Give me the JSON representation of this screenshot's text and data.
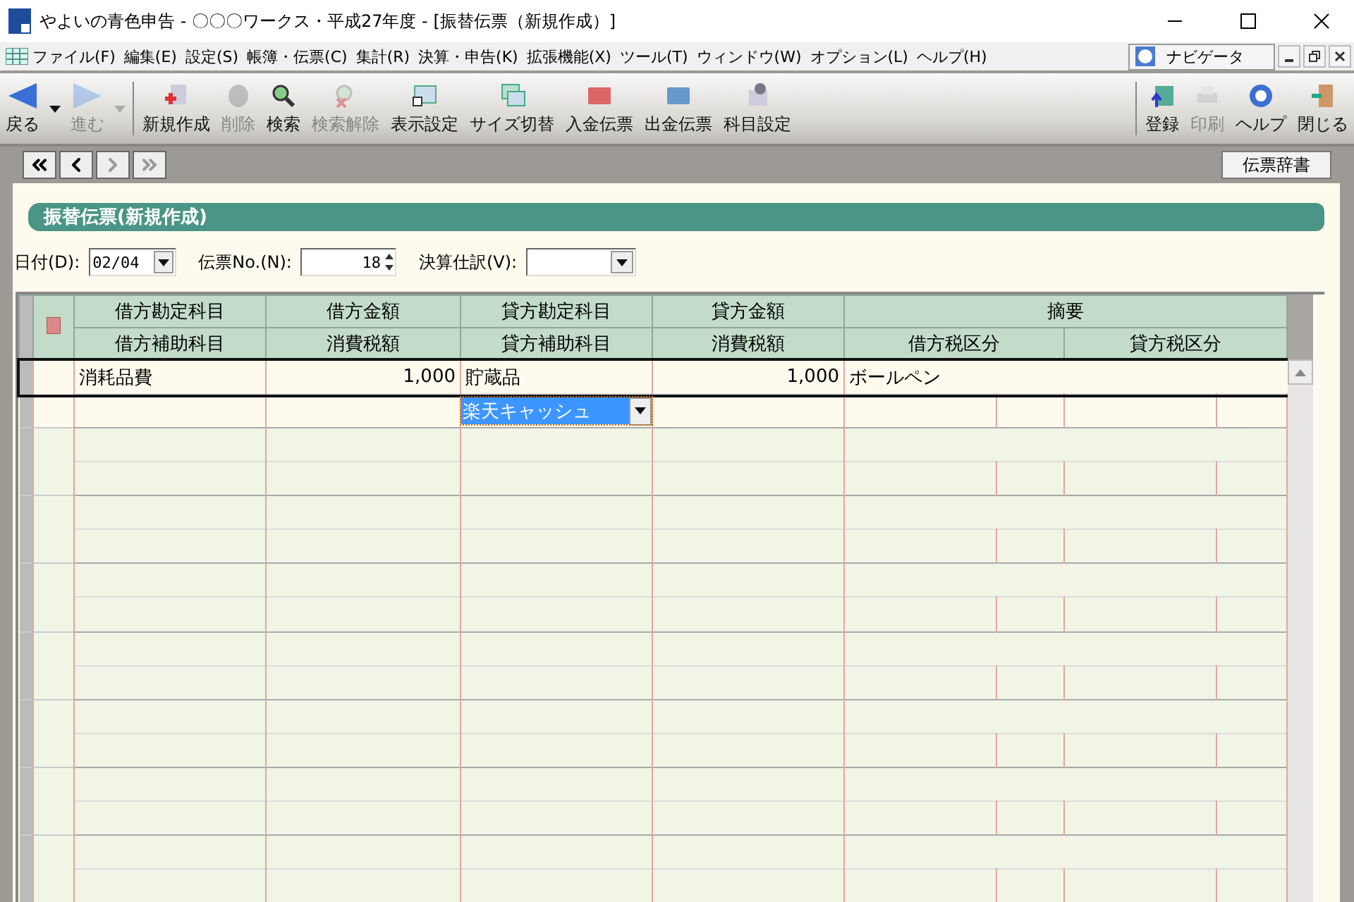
{
  "window": {
    "title": "やよいの青色申告 - 〇〇〇ワークス・平成27年度 - [振替伝票（新規作成）]"
  },
  "menu_bar": {
    "items": [
      "ファイル(F)",
      "編集(E)",
      "設定(S)",
      "帳簿・伝票(C)",
      "集計(R)",
      "決算・申告(K)",
      "拡張機能(X)",
      "ツール(T)",
      "ウィンドウ(W)",
      "オプション(L)",
      "ヘルプ(H)"
    ],
    "navigator": "ナビゲータ"
  },
  "toolbar": {
    "items": [
      {
        "label": "戻る",
        "disabled": false,
        "dropdown": true
      },
      {
        "label": "進む",
        "disabled": true,
        "dropdown": true
      },
      {
        "label": "新規作成",
        "disabled": false,
        "dropdown": false
      },
      {
        "label": "削除",
        "disabled": true,
        "dropdown": false
      },
      {
        "label": "検索",
        "disabled": false,
        "dropdown": false
      },
      {
        "label": "検索解除",
        "disabled": true,
        "dropdown": false
      },
      {
        "label": "表示設定",
        "disabled": false,
        "dropdown": false
      },
      {
        "label": "サイズ切替",
        "disabled": false,
        "dropdown": false
      },
      {
        "label": "入金伝票",
        "disabled": false,
        "dropdown": false
      },
      {
        "label": "出金伝票",
        "disabled": false,
        "dropdown": false
      },
      {
        "label": "科目設定",
        "disabled": false,
        "dropdown": false
      }
    ],
    "right_items": [
      {
        "label": "登録",
        "disabled": false
      },
      {
        "label": "印刷",
        "disabled": true
      },
      {
        "label": "ヘルプ",
        "disabled": false
      },
      {
        "label": "閉じる",
        "disabled": false
      }
    ]
  },
  "dictionary_button": "伝票辞書",
  "panel": {
    "title": "振替伝票(新規作成)"
  },
  "form": {
    "date": {
      "label": "日付(D):",
      "value": "02/04"
    },
    "voucher_no": {
      "label": "伝票No.(N):",
      "value": "18"
    },
    "closing_entry": {
      "label": "決算仕訳(V):"
    }
  },
  "grid": {
    "header_row_1": [
      "借方勘定科目",
      "借方金額",
      "貸方勘定科目",
      "貸方金額",
      "摘要"
    ],
    "header_row_2": [
      "借方補助科目",
      "消費税額",
      "貸方補助科目",
      "消費税額",
      "借方税区分",
      "貸方税区分"
    ],
    "entries": [
      {
        "debit_account": "消耗品費",
        "debit_amount": "1,000",
        "credit_account": "貯蔵品",
        "credit_amount": "1,000",
        "description": "ボールペン",
        "credit_sub_account": "楽天キャッシュ",
        "credit_sub_selected": true
      }
    ]
  }
}
